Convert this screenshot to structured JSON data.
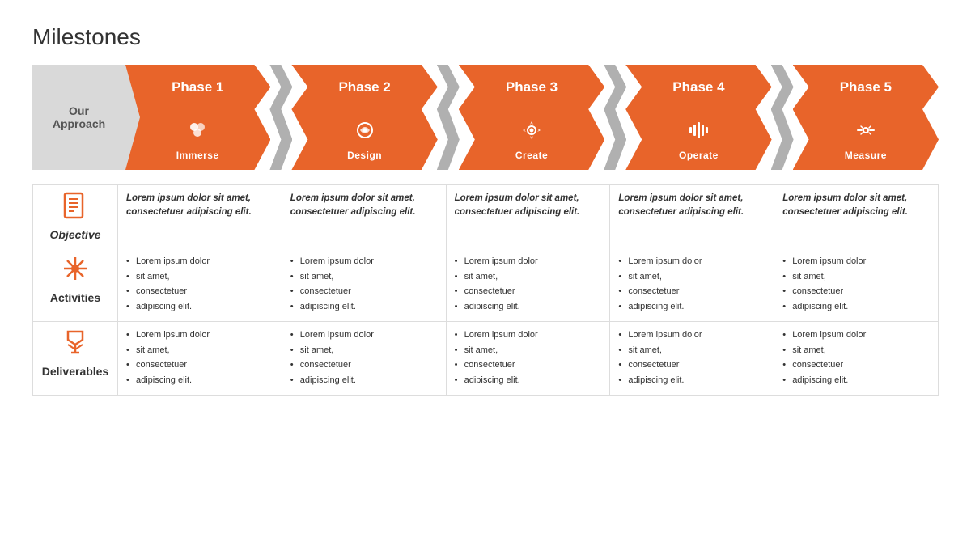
{
  "title": "Milestones",
  "ourApproach": "Our\nApproach",
  "phases": [
    {
      "id": 1,
      "label": "Phase 1",
      "name": "Immerse",
      "color": "orange",
      "icon": "immerse"
    },
    {
      "id": 2,
      "label": "Phase 2",
      "name": "Design",
      "color": "orange",
      "icon": "design"
    },
    {
      "id": 3,
      "label": "Phase 3",
      "name": "Create",
      "color": "orange",
      "icon": "create"
    },
    {
      "id": 4,
      "label": "Phase 4",
      "name": "Operate",
      "color": "orange",
      "icon": "operate"
    },
    {
      "id": 5,
      "label": "Phase 5",
      "name": "Measure",
      "color": "orange",
      "icon": "measure"
    }
  ],
  "rows": {
    "objective": {
      "label": "Objective",
      "text": "Lorem ipsum dolor sit amet, consectetuer adipiscing elit."
    },
    "activities": {
      "label": "Activities",
      "items": [
        "Lorem ipsum dolor",
        "sit amet,",
        "consectetuer",
        "adipiscing elit."
      ]
    },
    "deliverables": {
      "label": "Deliverables",
      "items": [
        "Lorem ipsum dolor",
        "sit amet,",
        "consectetuer",
        "adipiscing elit."
      ]
    }
  }
}
